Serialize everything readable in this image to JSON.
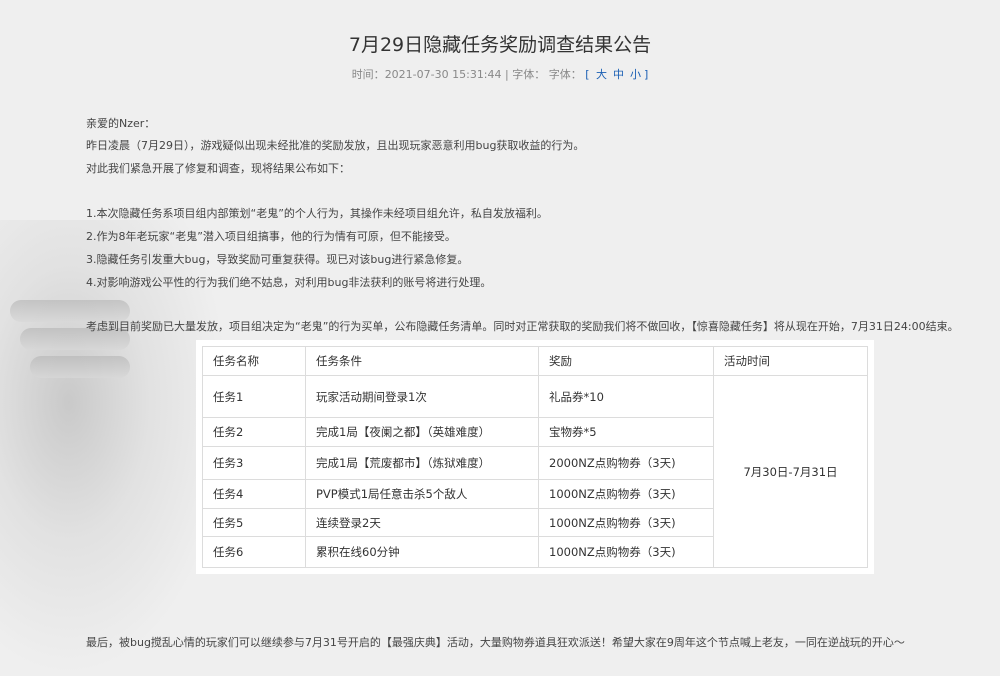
{
  "article": {
    "title": "7月29日隐藏任务奖励调查结果公告",
    "meta_time_label": "时间：",
    "meta_time": "2021-07-30 15:31:44",
    "meta_font_label": " | 字体：  字体：",
    "meta_size_open": "[",
    "meta_size_large": "大",
    "meta_size_medium": "中",
    "meta_size_small": "小",
    "meta_size_close": "]"
  },
  "body": {
    "greeting": "亲爱的Nzer：",
    "line1": "昨日凌晨（7月29日），游戏疑似出现未经批准的奖励发放，且出现玩家恶意利用bug获取收益的行为。",
    "line2": "对此我们紧急开展了修复和调查，现将结果公布如下：",
    "item1": "1.本次隐藏任务系项目组内部策划“老鬼”的个人行为，其操作未经项目组允许，私自发放福利。",
    "item2": "2.作为8年老玩家“老鬼”潜入项目组搞事，他的行为情有可原，但不能接受。",
    "item3": "3.隐藏任务引发重大bug，导致奖励可重复获得。现已对该bug进行紧急修复。",
    "item4": "4.对影响游戏公平性的行为我们绝不姑息，对利用bug非法获利的账号将进行处理。",
    "para": "考虑到目前奖励已大量发放，项目组决定为“老鬼”的行为买单，公布隐藏任务清单。同时对正常获取的奖励我们将不做回收，【惊喜隐藏任务】将从现在开始，7月31日24:00结束。",
    "closing": "最后，被bug搅乱心情的玩家们可以继续参与7月31号开启的【最强庆典】活动，大量购物券道具狂欢派送！希望大家在9周年这个节点喊上老友，一同在逆战玩的开心～"
  },
  "table": {
    "headers": [
      "任务名称",
      "任务条件",
      "奖励",
      "活动时间"
    ],
    "rows": [
      [
        "任务1",
        "玩家活动期间登录1次",
        "礼品券*10"
      ],
      [
        "任务2",
        "完成1局【夜阑之都】（英雄难度）",
        "宝物券*5"
      ],
      [
        "任务3",
        "完成1局【荒废都市】（炼狱难度）",
        "2000NZ点购物券（3天)"
      ],
      [
        "任务4",
        "PVP模式1局任意击杀5个敌人",
        "1000NZ点购物券（3天)"
      ],
      [
        "任务5",
        "连续登录2天",
        "1000NZ点购物券（3天)"
      ],
      [
        "任务6",
        "累积在线60分钟",
        "1000NZ点购物券（3天)"
      ]
    ],
    "period": "7月30日-7月31日"
  }
}
